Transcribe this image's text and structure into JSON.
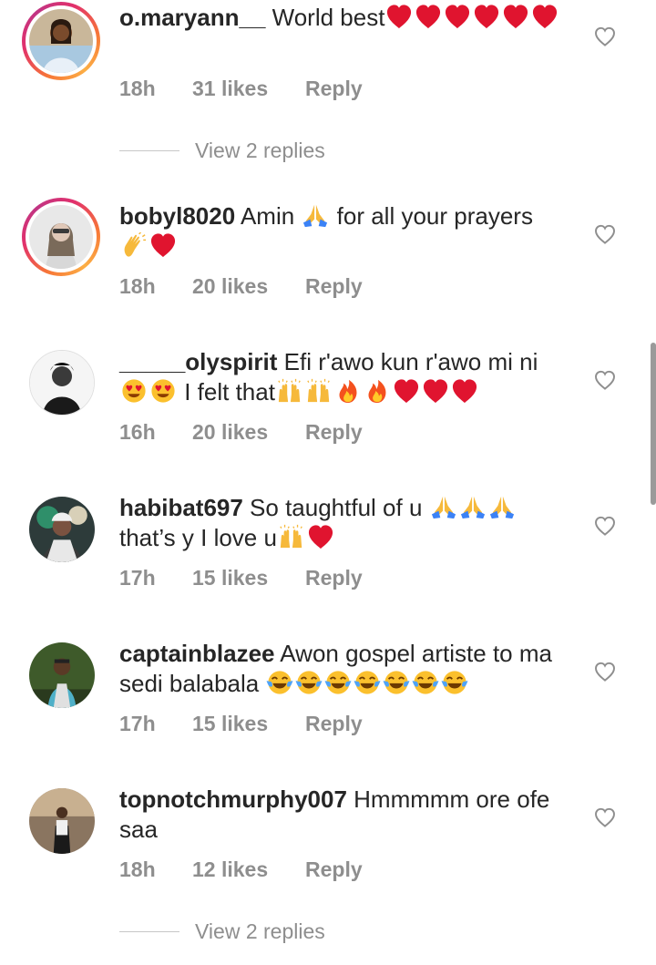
{
  "comments": [
    {
      "username": "o.maryann__",
      "text_parts": [
        " World best"
      ],
      "time": "18h",
      "likes": "31 likes",
      "reply": "Reply",
      "view_replies": "View 2 replies"
    },
    {
      "username": "bobyl8020",
      "text_parts": [
        " Amin ",
        " for all your prayers"
      ],
      "time": "18h",
      "likes": "20 likes",
      "reply": "Reply"
    },
    {
      "username": "_____olyspirit",
      "text_parts": [
        " Efi r'awo kun r'awo mi ni",
        " I felt that"
      ],
      "time": "16h",
      "likes": "20 likes",
      "reply": "Reply"
    },
    {
      "username": "habibat697",
      "text_parts": [
        " So taughtful of u ",
        "that’s y I love u"
      ],
      "time": "17h",
      "likes": "15 likes",
      "reply": "Reply"
    },
    {
      "username": "captainblazee",
      "text_parts": [
        " Awon gospel artiste to ma sedi balabala "
      ],
      "time": "17h",
      "likes": "15 likes",
      "reply": "Reply"
    },
    {
      "username": "topnotchmurphy007",
      "text_parts": [
        " Hmmmmm ore ofe saa"
      ],
      "time": "18h",
      "likes": "12 likes",
      "reply": "Reply",
      "view_replies": "View 2 replies"
    }
  ],
  "icons": {
    "like": "heart-outline-icon",
    "emoji_red_heart": "red-heart-emoji",
    "emoji_pray": "folded-hands-emoji",
    "emoji_clap": "clapping-hands-emoji",
    "emoji_heart_eyes": "heart-eyes-emoji",
    "emoji_raise_hands": "raising-hands-emoji",
    "emoji_fire": "fire-emoji",
    "emoji_joy": "tears-of-joy-emoji"
  },
  "colors": {
    "text": "#262626",
    "muted": "#8e8e8e",
    "heart_red": "#e0245e",
    "story_ring_start": "#f77737",
    "story_ring_end": "#c13584"
  }
}
